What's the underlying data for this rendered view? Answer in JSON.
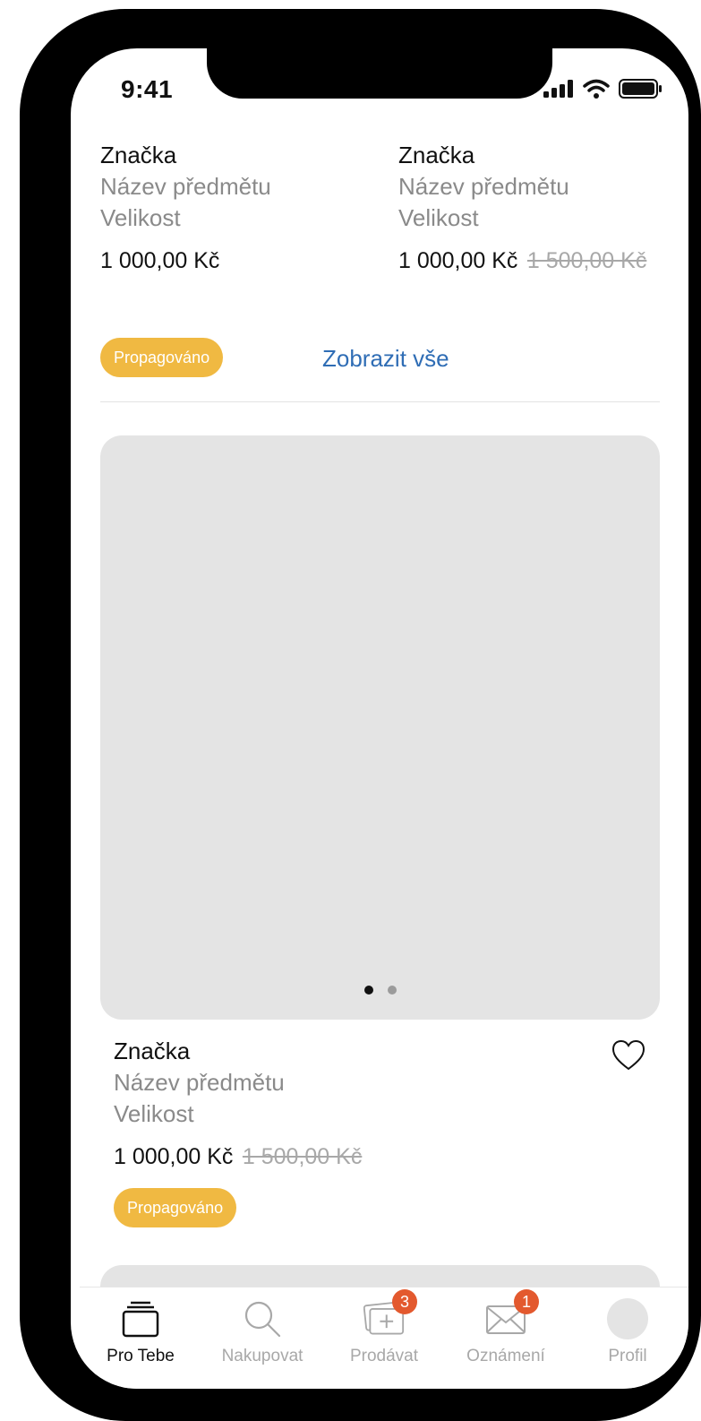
{
  "status_bar": {
    "time": "9:41"
  },
  "top_products": [
    {
      "brand": "Značka",
      "name": "Název předmětu",
      "size": "Velikost",
      "price": "1 000,00 Kč",
      "old_price": ""
    },
    {
      "brand": "Značka",
      "name": "Název předmětu",
      "size": "Velikost",
      "price": "1 000,00 Kč",
      "old_price": "1 500,00 Kč"
    }
  ],
  "section": {
    "badge_label": "Propagováno",
    "view_all_label": "Zobrazit vše"
  },
  "featured_product": {
    "brand": "Značka",
    "name": "Název předmětu",
    "size": "Velikost",
    "price": "1 000,00 Kč",
    "old_price": "1 500,00 Kč",
    "badge_label": "Propagováno",
    "image_pages": 2,
    "active_page": 1
  },
  "tabbar": {
    "items": [
      {
        "label": "Pro Tebe",
        "icon": "cards-stack-icon",
        "active": true,
        "badge": ""
      },
      {
        "label": "Nakupovat",
        "icon": "search-icon",
        "active": false,
        "badge": ""
      },
      {
        "label": "Prodávat",
        "icon": "add-photo-icon",
        "active": false,
        "badge": "3"
      },
      {
        "label": "Oznámení",
        "icon": "envelope-icon",
        "active": false,
        "badge": "1"
      },
      {
        "label": "Profil",
        "icon": "avatar",
        "active": false,
        "badge": ""
      }
    ]
  },
  "colors": {
    "promo_badge": "#f0b942",
    "link": "#2f6db5",
    "notification": "#e3592e",
    "placeholder": "#e4e4e4"
  }
}
